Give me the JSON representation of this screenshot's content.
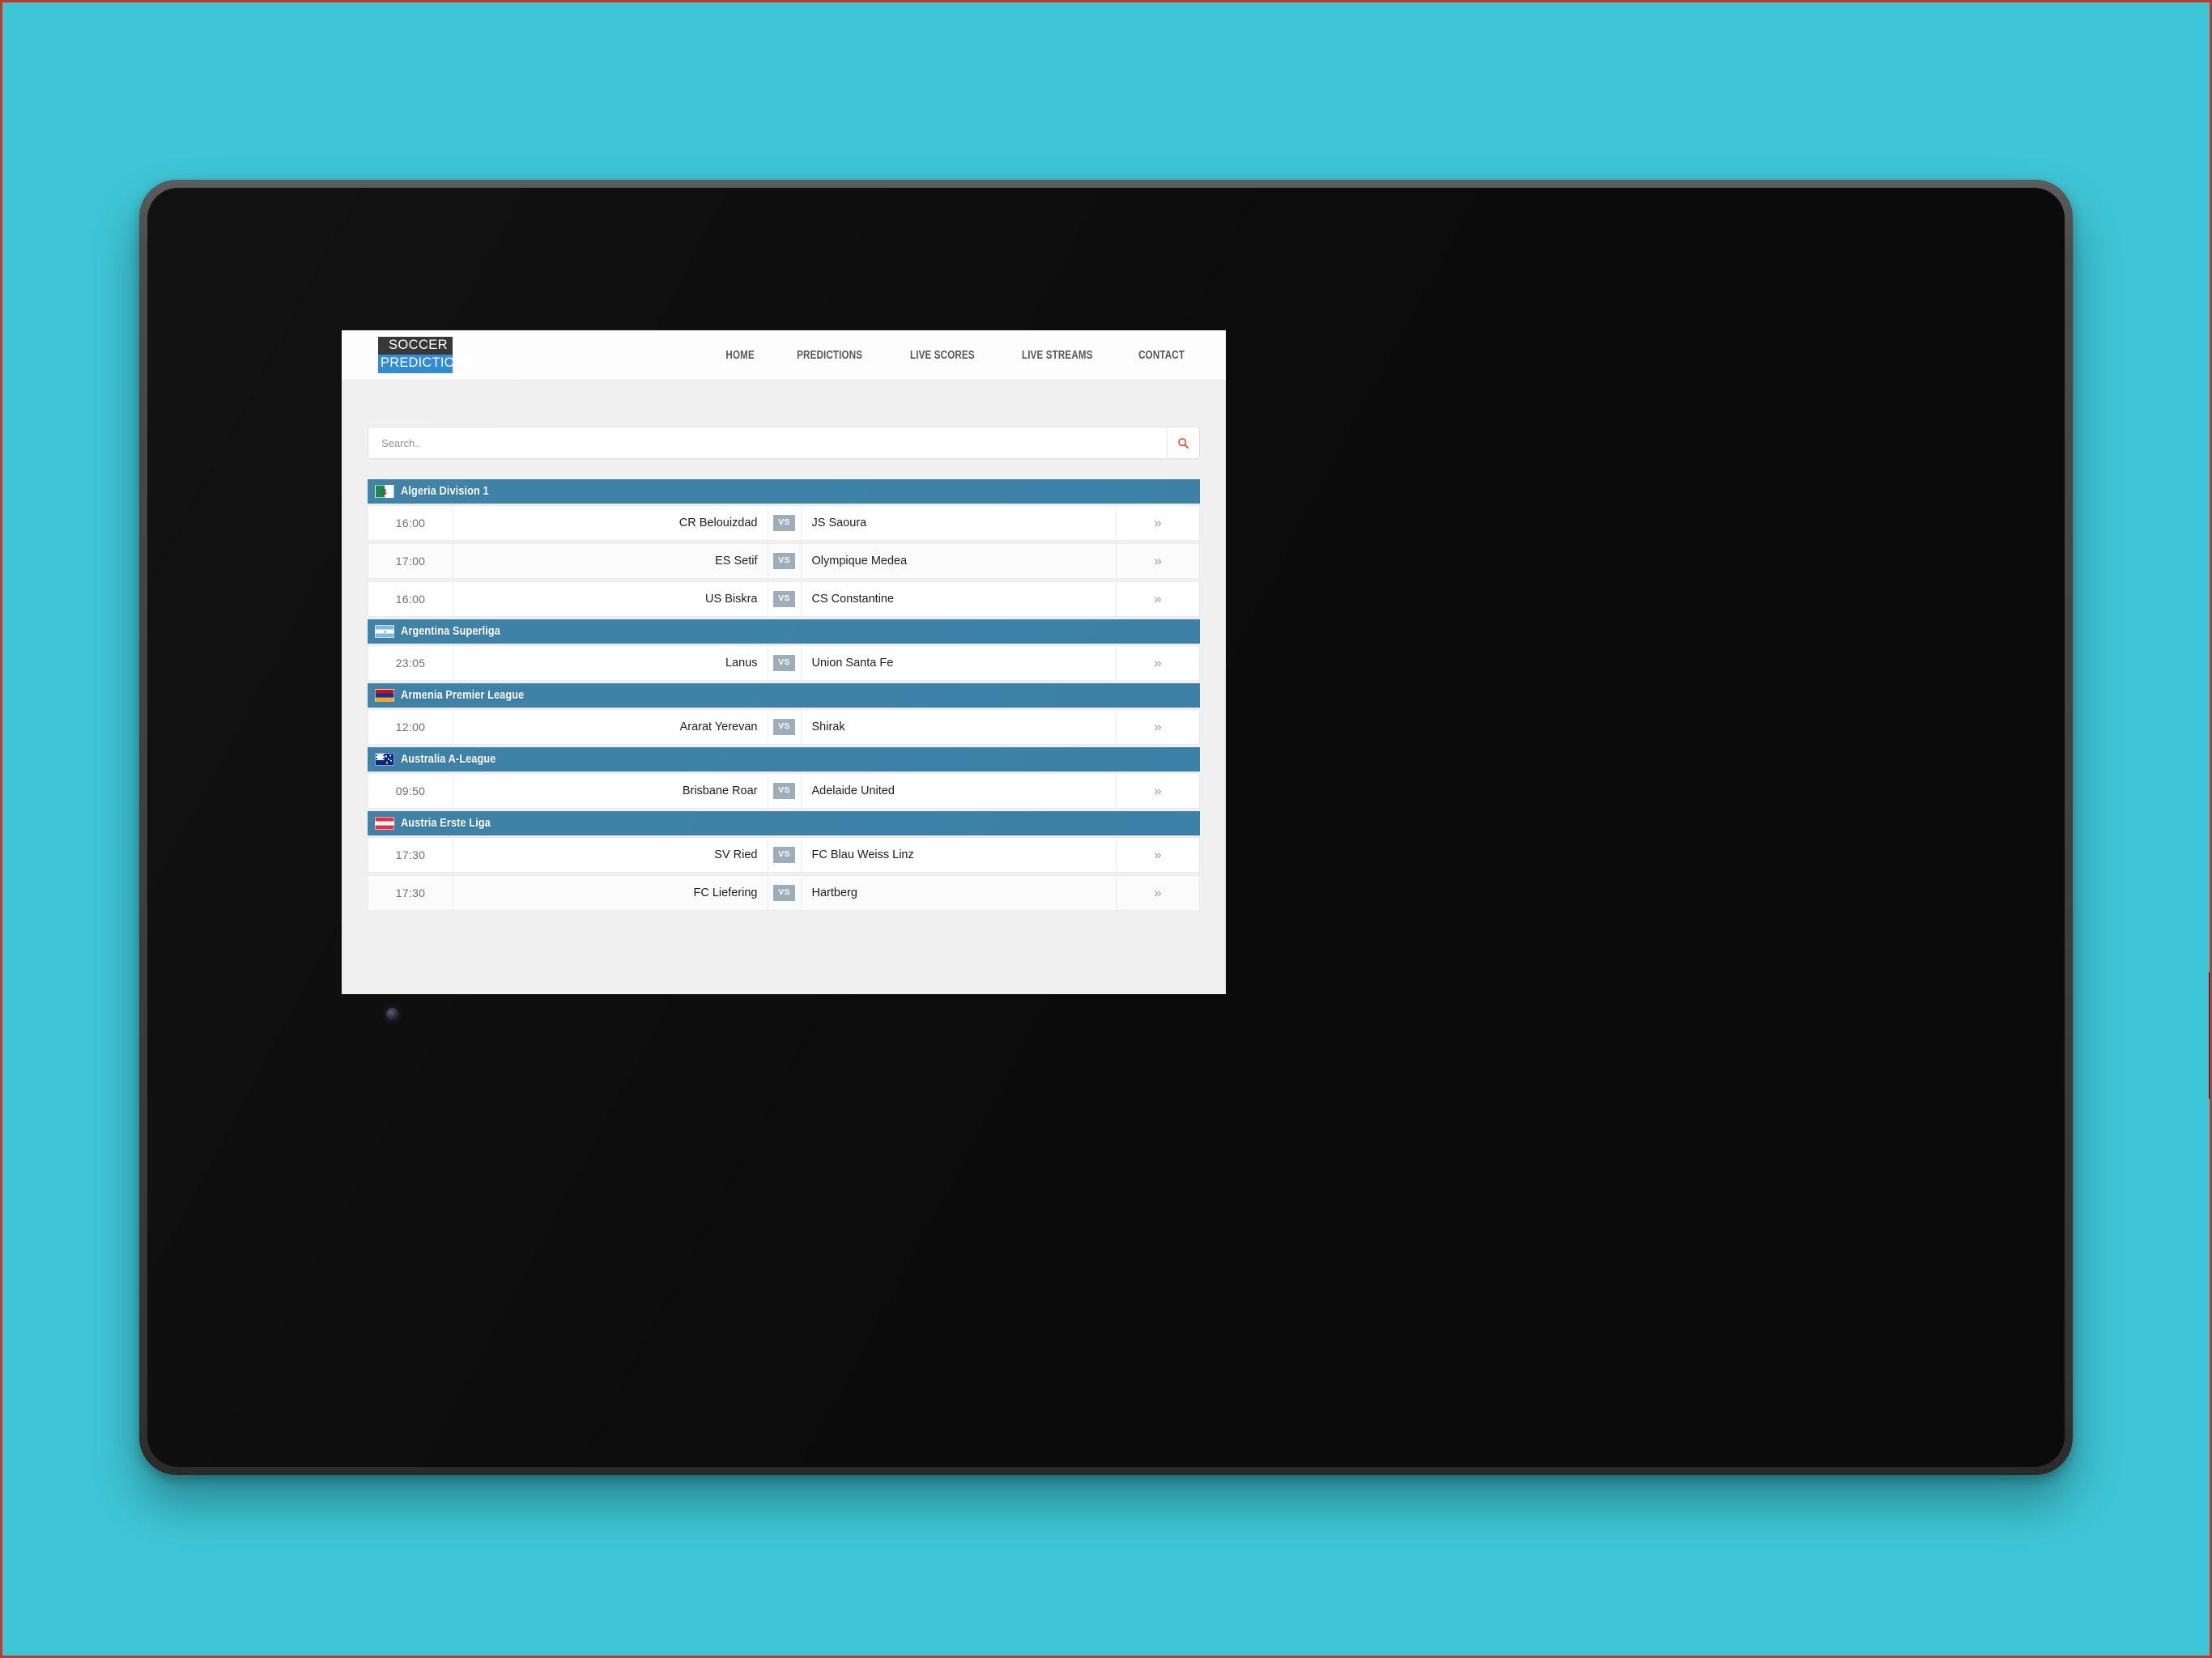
{
  "site": {
    "logo_top": "SOCCER",
    "logo_bottom": "PREDICTIONS"
  },
  "nav": {
    "items": [
      {
        "label": "HOME"
      },
      {
        "label": "PREDICTIONS"
      },
      {
        "label": "LIVE SCORES"
      },
      {
        "label": "LIVE STREAMS"
      },
      {
        "label": "CONTACT"
      }
    ]
  },
  "search": {
    "placeholder": "Search..",
    "value": "",
    "icon": "search-icon",
    "icon_color": "#e04a32"
  },
  "theme": {
    "page_background": "#f0f0f0",
    "league_header": "#3b80a6",
    "vs_badge": "#9bacba",
    "logo_blue": "#2d88d4",
    "logo_dark": "#333333",
    "canvas_background": "#3ec6d6"
  },
  "row_action_icon": "»",
  "vs_label": "vs",
  "leagues": [
    {
      "name": "Algeria Division 1",
      "flag": "algeria",
      "matches": [
        {
          "time": "16:00",
          "home": "CR Belouizdad",
          "away": "JS Saoura"
        },
        {
          "time": "17:00",
          "home": "ES Setif",
          "away": "Olympique Medea"
        },
        {
          "time": "16:00",
          "home": "US Biskra",
          "away": "CS Constantine"
        }
      ]
    },
    {
      "name": "Argentina Superliga",
      "flag": "argentina",
      "matches": [
        {
          "time": "23:05",
          "home": "Lanus",
          "away": "Union Santa Fe"
        }
      ]
    },
    {
      "name": "Armenia Premier League",
      "flag": "armenia",
      "matches": [
        {
          "time": "12:00",
          "home": "Ararat Yerevan",
          "away": "Shirak"
        }
      ]
    },
    {
      "name": "Australia A-League",
      "flag": "australia",
      "matches": [
        {
          "time": "09:50",
          "home": "Brisbane Roar",
          "away": "Adelaide United"
        }
      ]
    },
    {
      "name": "Austria Erste Liga",
      "flag": "austria",
      "matches": [
        {
          "time": "17:30",
          "home": "SV Ried",
          "away": "FC Blau Weiss Linz"
        },
        {
          "time": "17:30",
          "home": "FC Liefering",
          "away": "Hartberg"
        }
      ]
    }
  ]
}
